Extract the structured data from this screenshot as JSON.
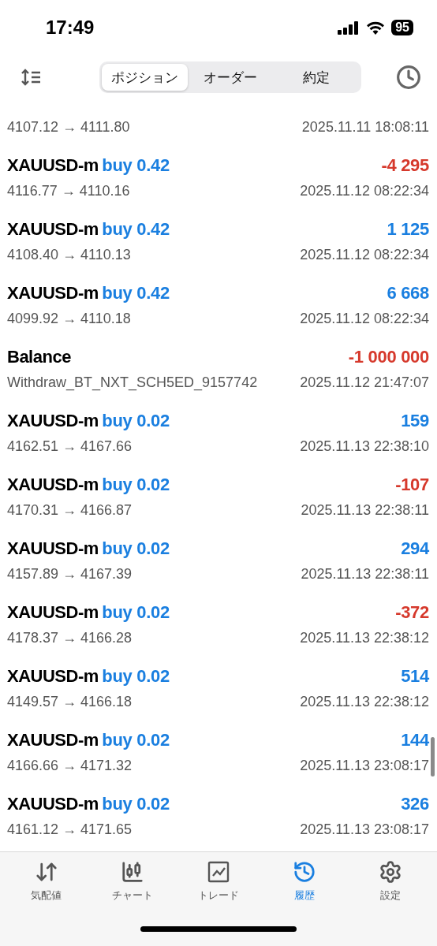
{
  "status_bar": {
    "time": "17:49",
    "battery": "95"
  },
  "tabs": [
    {
      "label": "ポジション",
      "selected": true
    },
    {
      "label": "オーダー",
      "selected": false
    },
    {
      "label": "約定",
      "selected": false
    }
  ],
  "deals": [
    {
      "kind": "partial",
      "detail": "4107.12 → 4111.80",
      "time": "2025.11.11 18:08:11"
    },
    {
      "kind": "trade",
      "symbol": "XAUUSD-m",
      "order": "buy 0.42",
      "profit": "-4 295",
      "color": "#d6392c",
      "detail": "4116.77 → 4110.16",
      "time": "2025.11.12 08:22:34"
    },
    {
      "kind": "trade",
      "symbol": "XAUUSD-m",
      "order": "buy 0.42",
      "profit": "1 125",
      "color": "#1a7fe0",
      "detail": "4108.40 → 4110.13",
      "time": "2025.11.12 08:22:34"
    },
    {
      "kind": "trade",
      "symbol": "XAUUSD-m",
      "order": "buy 0.42",
      "profit": "6 668",
      "color": "#1a7fe0",
      "detail": "4099.92 → 4110.18",
      "time": "2025.11.12 08:22:34"
    },
    {
      "kind": "balance",
      "symbol": "Balance",
      "profit": "-1 000 000",
      "color": "#d6392c",
      "detail": "Withdraw_BT_NXT_SCH5ED_9157742",
      "time": "2025.11.12 21:47:07"
    },
    {
      "kind": "trade",
      "symbol": "XAUUSD-m",
      "order": "buy 0.02",
      "profit": "159",
      "color": "#1a7fe0",
      "detail": "4162.51 → 4167.66",
      "time": "2025.11.13 22:38:10"
    },
    {
      "kind": "trade",
      "symbol": "XAUUSD-m",
      "order": "buy 0.02",
      "profit": "-107",
      "color": "#d6392c",
      "detail": "4170.31 → 4166.87",
      "time": "2025.11.13 22:38:11"
    },
    {
      "kind": "trade",
      "symbol": "XAUUSD-m",
      "order": "buy 0.02",
      "profit": "294",
      "color": "#1a7fe0",
      "detail": "4157.89 → 4167.39",
      "time": "2025.11.13 22:38:11"
    },
    {
      "kind": "trade",
      "symbol": "XAUUSD-m",
      "order": "buy 0.02",
      "profit": "-372",
      "color": "#d6392c",
      "detail": "4178.37 → 4166.28",
      "time": "2025.11.13 22:38:12"
    },
    {
      "kind": "trade",
      "symbol": "XAUUSD-m",
      "order": "buy 0.02",
      "profit": "514",
      "color": "#1a7fe0",
      "detail": "4149.57 → 4166.18",
      "time": "2025.11.13 22:38:12"
    },
    {
      "kind": "trade",
      "symbol": "XAUUSD-m",
      "order": "buy 0.02",
      "profit": "144",
      "color": "#1a7fe0",
      "detail": "4166.66 → 4171.32",
      "time": "2025.11.13 23:08:17"
    },
    {
      "kind": "trade",
      "symbol": "XAUUSD-m",
      "order": "buy 0.02",
      "profit": "326",
      "color": "#1a7fe0",
      "detail": "4161.12 → 4171.65",
      "time": "2025.11.13 23:08:17"
    }
  ],
  "nav": [
    {
      "label": "気配値",
      "selected": false
    },
    {
      "label": "チャート",
      "selected": false
    },
    {
      "label": "トレード",
      "selected": false
    },
    {
      "label": "履歴",
      "selected": true
    },
    {
      "label": "設定",
      "selected": false
    }
  ]
}
